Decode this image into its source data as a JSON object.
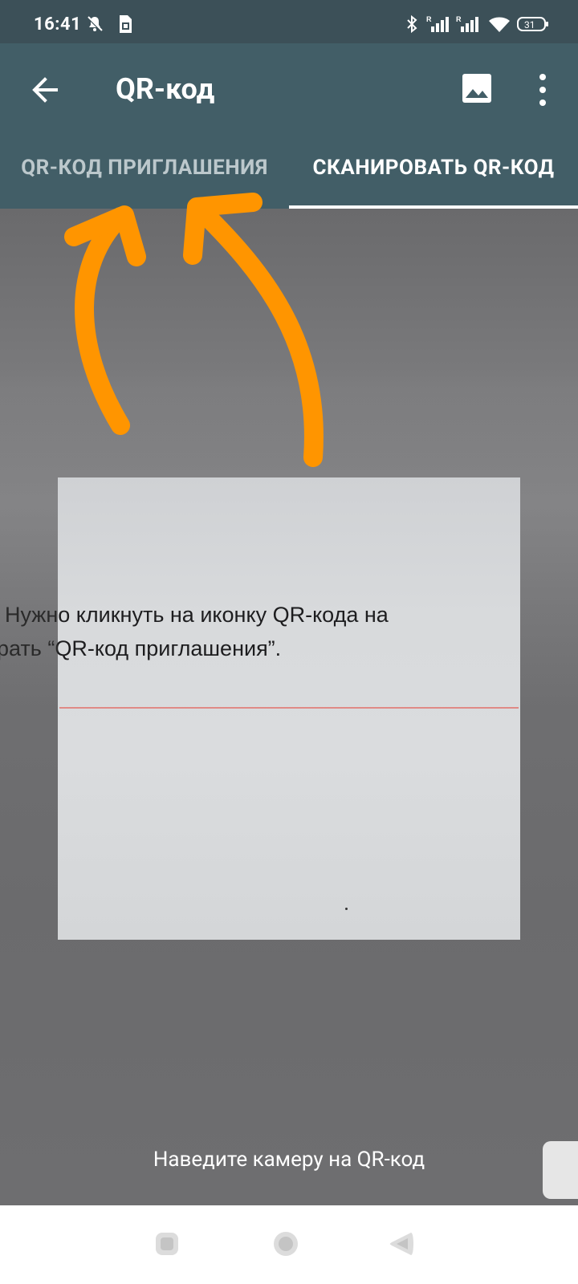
{
  "status_bar": {
    "time": "16:41",
    "icons": [
      "mute-bell-icon",
      "sim-card-icon",
      "bluetooth-icon",
      "signal-r-icon",
      "signal-r-icon",
      "wifi-icon",
      "battery-icon"
    ],
    "battery_level": "31"
  },
  "app_bar": {
    "title": "QR-код",
    "back_icon": "arrow-back-icon",
    "gallery_icon": "image-icon",
    "more_icon": "more-vert-icon",
    "background_color": "#425e67"
  },
  "tabs": [
    {
      "label": "QR-КОД ПРИГЛАШЕНИЯ",
      "selected": false
    },
    {
      "label": "СКАНИРОВАТЬ QR-КОД",
      "selected": true
    }
  ],
  "camera": {
    "visible_text_line1": "Нужно кликнуть на иконку QR-кода на",
    "visible_text_line2": "рать “QR-код приглашения”.",
    "hint": "Наведите камеру на QR-код"
  },
  "annotation": {
    "arrow_color": "#ff9500",
    "arrow_count": 2
  },
  "nav_bar": {
    "icons": [
      "recents-square-icon",
      "home-circle-icon",
      "back-triangle-icon"
    ]
  }
}
